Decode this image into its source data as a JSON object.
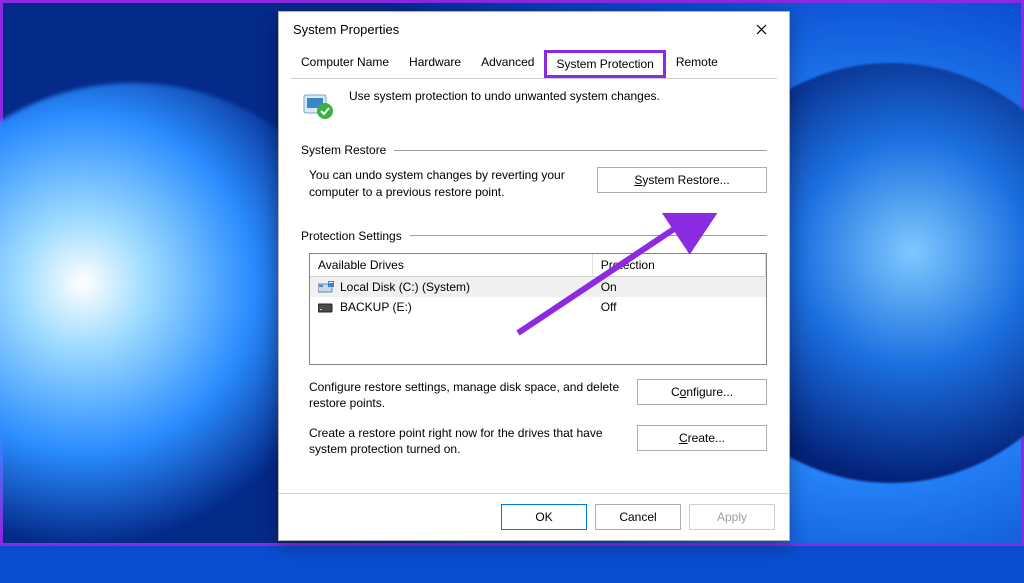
{
  "window_title": "System Properties",
  "tabs": [
    "Computer Name",
    "Hardware",
    "Advanced",
    "System Protection",
    "Remote"
  ],
  "active_tab_index": 3,
  "intro_text": "Use system protection to undo unwanted system changes.",
  "sections": {
    "restore": {
      "title": "System Restore",
      "text": "You can undo system changes by reverting your computer to a previous restore point.",
      "button": "System Restore..."
    },
    "protection": {
      "title": "Protection Settings",
      "columns": {
        "drive": "Available Drives",
        "protection": "Protection"
      },
      "drives": [
        {
          "name": "Local Disk (C:) (System)",
          "protection": "On",
          "icon": "disk-system",
          "selected": true
        },
        {
          "name": "BACKUP (E:)",
          "protection": "Off",
          "icon": "disk",
          "selected": false
        }
      ],
      "configure_text": "Configure restore settings, manage disk space, and delete restore points.",
      "configure_button": "Configure...",
      "create_text": "Create a restore point right now for the drives that have system protection turned on.",
      "create_button": "Create..."
    }
  },
  "footer_buttons": {
    "ok": "OK",
    "cancel": "Cancel",
    "apply": "Apply"
  },
  "annotation": {
    "highlight_color": "#8a2be2"
  }
}
